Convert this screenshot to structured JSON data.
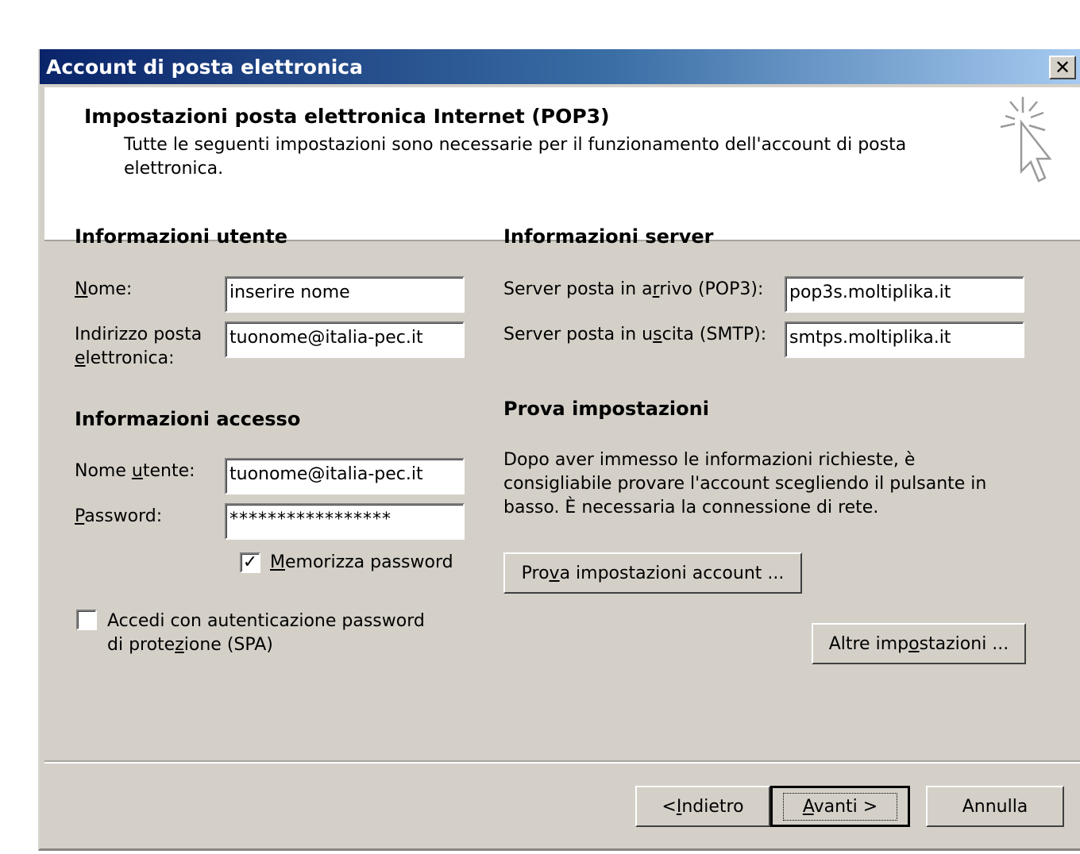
{
  "window": {
    "title": "Account di posta elettronica",
    "close_label": "✕"
  },
  "header": {
    "title": "Impostazioni posta elettronica Internet (POP3)",
    "description": "Tutte le seguenti impostazioni sono necessarie per il funzionamento dell'account di posta elettronica."
  },
  "user_info": {
    "title": "Informazioni utente",
    "name_label_u": "N",
    "name_label_rest": "ome:",
    "name_value": "inserire nome",
    "email_label_line1": "Indirizzo posta",
    "email_label_u": "e",
    "email_label_rest": "lettronica:",
    "email_value": "tuonome@italia-pec.it"
  },
  "access_info": {
    "title": "Informazioni accesso",
    "username_label_pre": "Nome ",
    "username_label_u": "u",
    "username_label_rest": "tente:",
    "username_value": "tuonome@italia-pec.it",
    "password_label_u": "P",
    "password_label_rest": "assword:",
    "password_value": "*****************",
    "remember_checked": "✓",
    "remember_label_u": "M",
    "remember_label_rest": "emorizza password",
    "spa_label_line1": "Accedi con autenticazione password",
    "spa_label_pre": "di prote",
    "spa_label_u": "z",
    "spa_label_rest": "ione (SPA)"
  },
  "server_info": {
    "title": "Informazioni server",
    "incoming_label_pre": "Server posta in a",
    "incoming_label_u": "r",
    "incoming_label_rest": "rivo (POP3):",
    "incoming_value": "pop3s.moltiplika.it",
    "outgoing_label_pre": "Server posta in u",
    "outgoing_label_u": "s",
    "outgoing_label_rest": "cita (SMTP):",
    "outgoing_value": "smtps.moltiplika.it"
  },
  "test_settings": {
    "title": "Prova impostazioni",
    "description": "Dopo aver immesso le informazioni richieste, è consigliabile provare l'account scegliendo il pulsante in basso. È necessaria la connessione di rete.",
    "test_button_pre": "Pro",
    "test_button_u": "v",
    "test_button_rest": "a impostazioni account ...",
    "more_button_pre": "Altre imp",
    "more_button_u": "o",
    "more_button_rest": "stazioni ..."
  },
  "footer": {
    "back_pre": "< ",
    "back_u": "I",
    "back_rest": "ndietro",
    "next_u": "A",
    "next_rest": "vanti >",
    "cancel": "Annulla"
  }
}
